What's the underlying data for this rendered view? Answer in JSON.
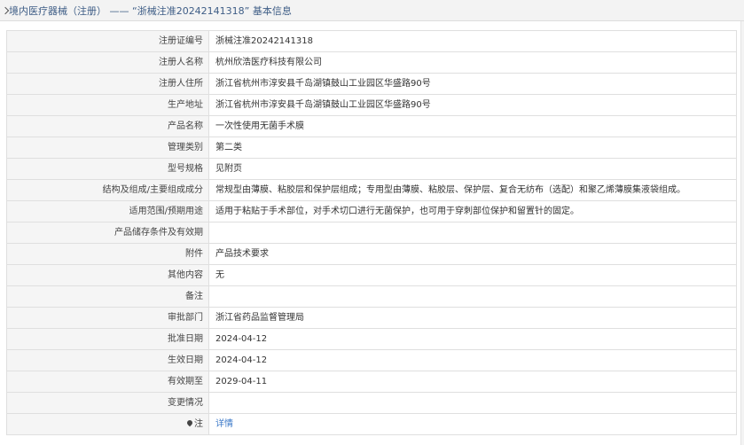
{
  "header": {
    "title": "境内医疗器械（注册） —— “浙械注准20242141318” 基本信息"
  },
  "rows": [
    {
      "label": "注册证编号",
      "value": "浙械注准20242141318"
    },
    {
      "label": "注册人名称",
      "value": "杭州欣浩医疗科技有限公司"
    },
    {
      "label": "注册人住所",
      "value": "浙江省杭州市淳安县千岛湖镇鼓山工业园区华盛路90号"
    },
    {
      "label": "生产地址",
      "value": "浙江省杭州市淳安县千岛湖镇鼓山工业园区华盛路90号"
    },
    {
      "label": "产品名称",
      "value": "一次性使用无菌手术膜"
    },
    {
      "label": "管理类别",
      "value": "第二类"
    },
    {
      "label": "型号规格",
      "value": "见附页"
    },
    {
      "label": "结构及组成/主要组成成分",
      "value": "常规型由薄膜、粘胶层和保护层组成；专用型由薄膜、粘胶层、保护层、复合无纺布（选配）和聚乙烯薄膜集液袋组成。"
    },
    {
      "label": "适用范围/预期用途",
      "value": "适用于粘贴于手术部位，对手术切口进行无菌保护，也可用于穿刺部位保护和留置针的固定。"
    },
    {
      "label": "产品储存条件及有效期",
      "value": ""
    },
    {
      "label": "附件",
      "value": "产品技术要求"
    },
    {
      "label": "其他内容",
      "value": "无"
    },
    {
      "label": "备注",
      "value": ""
    },
    {
      "label": "审批部门",
      "value": "浙江省药品监督管理局"
    },
    {
      "label": "批准日期",
      "value": "2024-04-12"
    },
    {
      "label": "生效日期",
      "value": "2024-04-12"
    },
    {
      "label": "有效期至",
      "value": "2029-04-11"
    },
    {
      "label": "变更情况",
      "value": ""
    }
  ],
  "note_row": {
    "label": "注",
    "icon": "note-pin-icon",
    "link_text": "详情"
  },
  "colors": {
    "title": "#3e5d86",
    "label_bg": "#f5f5f5",
    "border": "#dfdfdf",
    "link": "#3b78c8"
  }
}
